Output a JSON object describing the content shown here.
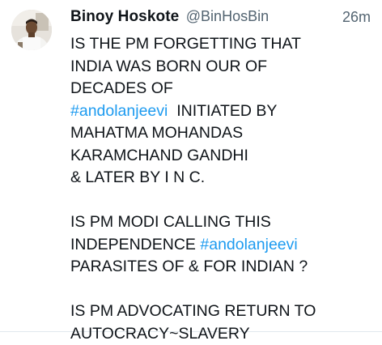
{
  "tweet": {
    "author": {
      "display_name": "Binoy Hoskote",
      "handle": "@BinHosBin"
    },
    "timestamp": "26m",
    "body": {
      "p1_l1": "IS THE PM FORGETTING THAT",
      "p1_l2": "INDIA WAS BORN OUR OF",
      "p1_l3": "DECADES OF",
      "hashtag_1": "#andolanjeevi",
      "p1_l4_rest": "  INITIATED BY",
      "p1_l5": "MAHATMA MOHANDAS",
      "p1_l6": "KARAMCHAND GANDHI",
      "p1_l7": "& LATER BY I N C.",
      "p2_l1": "IS PM MODI CALLING THIS",
      "p2_l2_start": "INDEPENDENCE ",
      "hashtag_2": "#andolanjeevi",
      "p2_l3": "PARASITES OF & FOR INDIAN ?",
      "p3_l1": "IS PM ADVOCATING RETURN TO",
      "p3_l2": "AUTOCRACY~SLAVERY"
    },
    "colors": {
      "hashtag": "#1d9bf0",
      "secondary_text": "#536471",
      "primary_text": "#0f1419"
    },
    "icons": {
      "avatar": "profile-photo"
    }
  }
}
